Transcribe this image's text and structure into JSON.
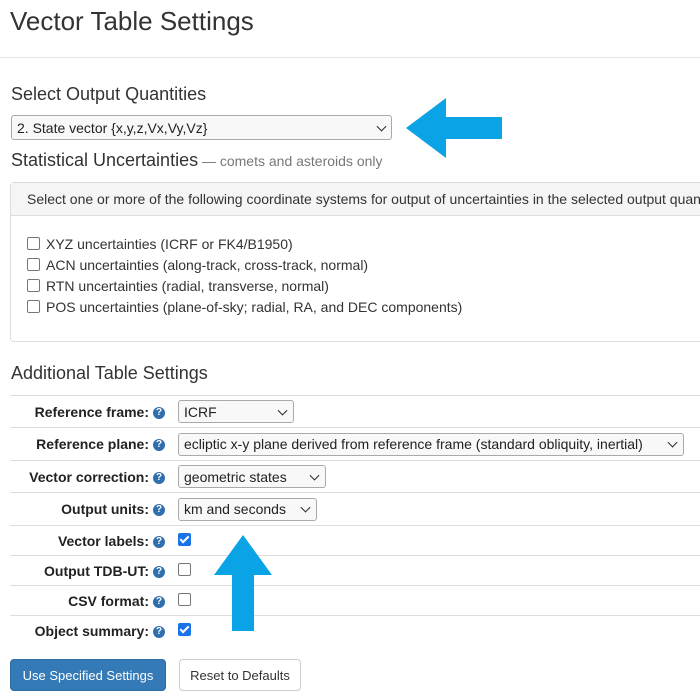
{
  "page": {
    "title": "Vector Table Settings"
  },
  "output_quantities": {
    "heading": "Select Output Quantities",
    "selected": "2. State vector {x,y,z,Vx,Vy,Vz}"
  },
  "uncertainties": {
    "heading": "Statistical Uncertainties",
    "note": "— comets and asteroids only",
    "instruction": "Select one or more of the following coordinate systems for output of uncertainties in the selected output quantities",
    "options": [
      {
        "label": "XYZ uncertainties (ICRF or FK4/B1950)",
        "checked": false
      },
      {
        "label": "ACN uncertainties (along-track, cross-track, normal)",
        "checked": false
      },
      {
        "label": "RTN uncertainties (radial, transverse, normal)",
        "checked": false
      },
      {
        "label": "POS uncertainties (plane-of-sky; radial, RA, and DEC components)",
        "checked": false
      }
    ]
  },
  "additional": {
    "heading": "Additional Table Settings",
    "rows": {
      "reference_frame": {
        "label": "Reference frame:",
        "value": "ICRF"
      },
      "reference_plane": {
        "label": "Reference plane:",
        "value": "ecliptic x-y plane derived from reference frame (standard obliquity, inertial)"
      },
      "vector_correction": {
        "label": "Vector correction:",
        "value": "geometric states"
      },
      "output_units": {
        "label": "Output units:",
        "value": "km and seconds"
      },
      "vector_labels": {
        "label": "Vector labels:",
        "checked": true
      },
      "output_tdb_ut": {
        "label": "Output TDB-UT:",
        "checked": false
      },
      "csv_format": {
        "label": "CSV format:",
        "checked": false
      },
      "object_summary": {
        "label": "Object summary:",
        "checked": true
      }
    }
  },
  "buttons": {
    "use_specified": "Use Specified Settings",
    "reset_defaults": "Reset to Defaults"
  },
  "icons": {
    "help": "?"
  },
  "colors": {
    "arrow": "#0aa3e6",
    "primary": "#337ab7",
    "checkbox_checked": "#1a73e8"
  }
}
